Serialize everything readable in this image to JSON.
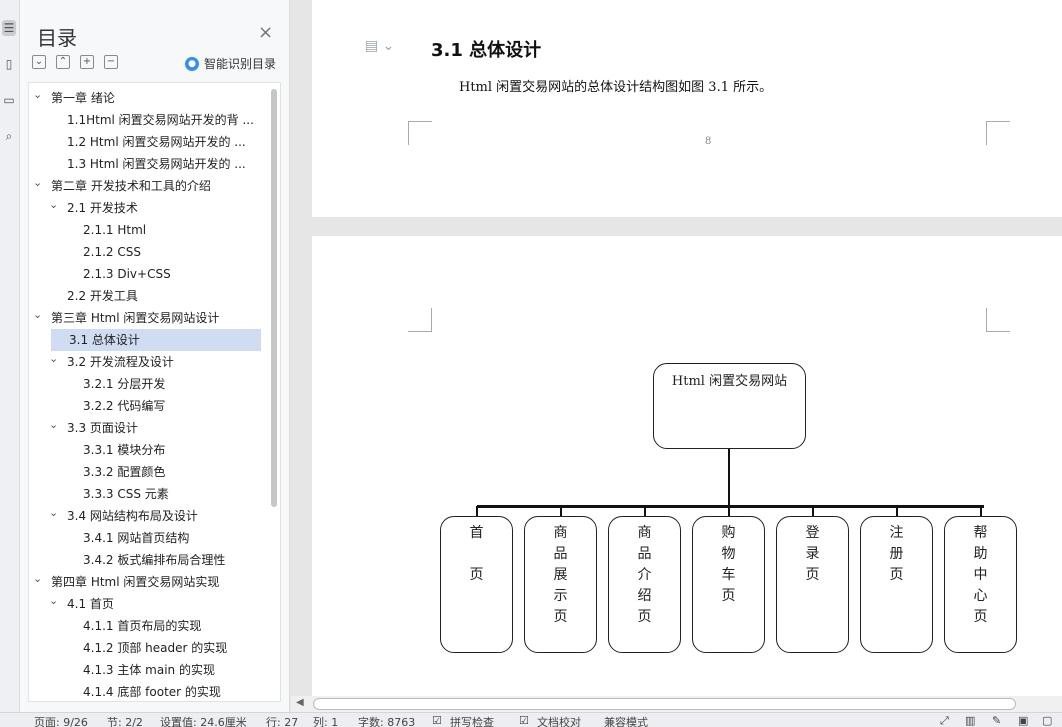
{
  "toc": {
    "title": "目录",
    "close_glyph": "×",
    "smart_toc": "智能识别目录",
    "items": [
      {
        "label": "第一章  绪论",
        "level": 0,
        "expanded": true
      },
      {
        "label": "1.1Html 闲置交易网站开发的背 ...",
        "level": 1
      },
      {
        "label": "1.2 Html 闲置交易网站开发的 ...",
        "level": 1
      },
      {
        "label": "1.3 Html 闲置交易网站开发的 ...",
        "level": 1
      },
      {
        "label": "第二章  开发技术和工具的介绍",
        "level": 0,
        "expanded": true
      },
      {
        "label": "2.1 开发技术",
        "level": 1,
        "expanded": true
      },
      {
        "label": "2.1.1 Html",
        "level": 2
      },
      {
        "label": "2.1.2 CSS",
        "level": 2
      },
      {
        "label": "2.1.3 Div+CSS",
        "level": 2
      },
      {
        "label": "2.2 开发工具",
        "level": 1
      },
      {
        "label": "第三章  Html 闲置交易网站设计",
        "level": 0,
        "expanded": true
      },
      {
        "label": "3.1 总体设计",
        "level": 1,
        "selected": true
      },
      {
        "label": "3.2 开发流程及设计",
        "level": 1,
        "expanded": true
      },
      {
        "label": "3.2.1  分层开发",
        "level": 2
      },
      {
        "label": "3.2.2  代码编写",
        "level": 2
      },
      {
        "label": "3.3 页面设计",
        "level": 1,
        "expanded": true
      },
      {
        "label": "3.3.1 模块分布",
        "level": 2
      },
      {
        "label": "3.3.2  配置颜色",
        "level": 2
      },
      {
        "label": "3.3.3 CSS 元素",
        "level": 2
      },
      {
        "label": "3.4 网站结构布局及设计",
        "level": 1,
        "expanded": true
      },
      {
        "label": "3.4.1  网站首页结构",
        "level": 2
      },
      {
        "label": "3.4.2  板式编排布局合理性",
        "level": 2
      },
      {
        "label": "第四章  Html 闲置交易网站实现",
        "level": 0,
        "expanded": true
      },
      {
        "label": "4.1 首页",
        "level": 1,
        "expanded": true
      },
      {
        "label": "4.1.1 首页布局的实现",
        "level": 2
      },
      {
        "label": "4.1.2  顶部 header 的实现",
        "level": 2
      },
      {
        "label": "4.1.3  主体 main 的实现",
        "level": 2
      },
      {
        "label": "4.1.4  底部 footer 的实现",
        "level": 2
      }
    ]
  },
  "document": {
    "heading": "3.1 总体设计",
    "paragraph": "Html 闲置交易网站的总体设计结构图如图 3.1 所示。",
    "page_number": "8",
    "diagram": {
      "root": "Html 闲置交易网站",
      "children": [
        "首\n\n页",
        "商\n品\n展\n示\n页",
        "商\n品\n介\n绍\n页",
        "购\n物\n车\n页",
        "登\n录\n页",
        "注\n册\n页",
        "帮\n助\n中\n心\n页"
      ]
    }
  },
  "statusbar": {
    "page": "页面: 9/26",
    "section": "节: 2/2",
    "setting": "设置值: 24.6厘米",
    "row": "行: 27",
    "col": "列: 1",
    "words": "字数: 8763",
    "spell": "拼写检查",
    "proof": "文档校对",
    "compat": "兼容模式"
  }
}
